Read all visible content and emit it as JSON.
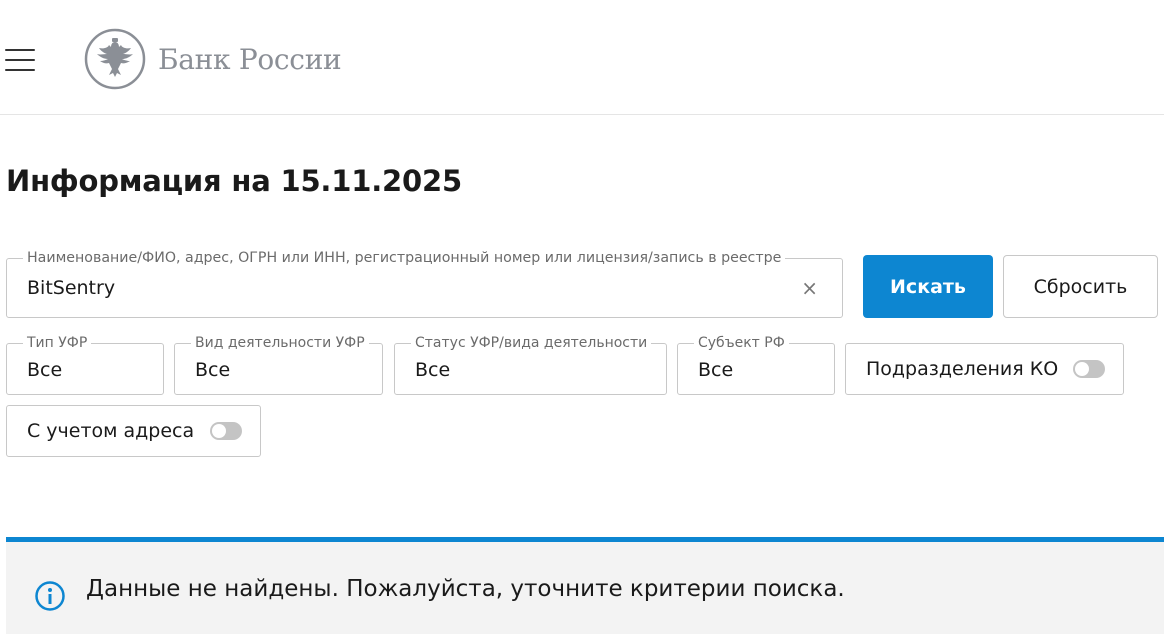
{
  "header": {
    "logo_text": "Банк России"
  },
  "page_title": "Информация на 15.11.2025",
  "search": {
    "label": "Наименование/ФИО, адрес, ОГРН или ИНН, регистрационный номер или лицензия/запись в реестре",
    "value": "BitSentry",
    "clear_glyph": "×"
  },
  "buttons": {
    "search": "Искать",
    "reset": "Сбросить"
  },
  "filters": [
    {
      "label": "Тип УФР",
      "value": "Все"
    },
    {
      "label": "Вид деятельности УФР",
      "value": "Все"
    },
    {
      "label": "Статус УФР/вида деятельности",
      "value": "Все"
    },
    {
      "label": "Субъект РФ",
      "value": "Все"
    }
  ],
  "toggles": [
    {
      "label": "Подразделения КО",
      "on": false
    },
    {
      "label": "С учетом адреса",
      "on": false
    }
  ],
  "alert": {
    "text": "Данные не найдены. Пожалуйста, уточните критерии поиска.",
    "icon": "info-icon"
  },
  "colors": {
    "accent": "#0d86d1",
    "logo_gray": "#8b8f96",
    "alert_bg": "#f3f3f3"
  }
}
